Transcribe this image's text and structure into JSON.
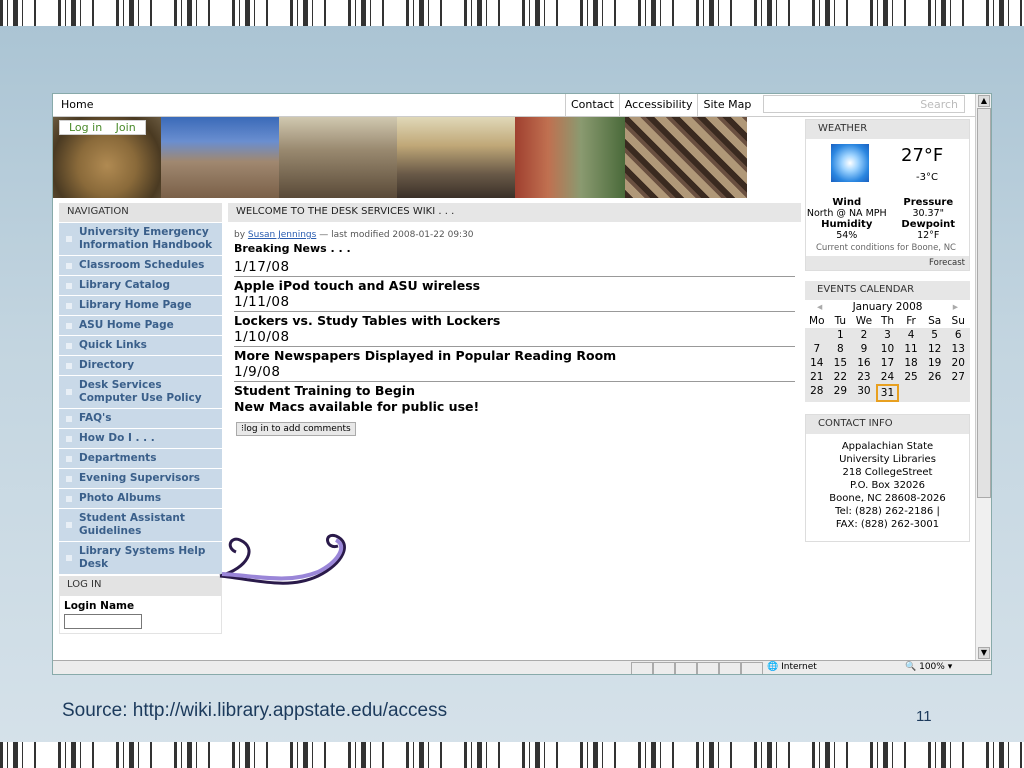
{
  "slide": {
    "source": "Source: http://wiki.library.appstate.edu/access",
    "page_number": "11"
  },
  "topnav": {
    "home": "Home",
    "links": [
      "Contact",
      "Accessibility",
      "Site Map"
    ],
    "search_placeholder": "Search"
  },
  "banner": {
    "login": "Log in",
    "join": "Join"
  },
  "nav": {
    "heading": "NAVIGATION",
    "items": [
      "University Emergency Information Handbook",
      "Classroom Schedules",
      "Library Catalog",
      "Library Home Page",
      "ASU Home Page",
      "Quick Links",
      "Directory",
      "Desk Services Computer Use Policy",
      "FAQ's",
      "How Do I . . .",
      "Departments",
      "Evening Supervisors",
      "Photo Albums",
      "Student Assistant Guidelines",
      "Library Systems Help Desk"
    ],
    "login_heading": "LOG IN",
    "login_label": "Login Name"
  },
  "content": {
    "heading": "WELCOME TO THE DESK SERVICES WIKI . . .",
    "byline_prefix": "by",
    "author": "Susan Jennings",
    "byline_suffix": "— last modified 2008-01-22 09:30",
    "breaking": "Breaking News . . .",
    "news": [
      {
        "date": "1/17/08",
        "title": "Apple iPod touch and ASU wireless"
      },
      {
        "date": "1/11/08",
        "title": "Lockers vs. Study Tables with Lockers"
      },
      {
        "date": "1/10/08",
        "title": "More Newspapers Displayed in Popular Reading Room"
      },
      {
        "date": "1/9/08",
        "title": "Student Training to Begin"
      }
    ],
    "extra_title": "New Macs available for public use!",
    "comment_button": "log in to add comments"
  },
  "weather": {
    "heading": "WEATHER",
    "temp_f": "27°F",
    "temp_c": "-3°C",
    "wind_label": "Wind",
    "wind_value": "North @ NA MPH",
    "pressure_label": "Pressure",
    "pressure_value": "30.37\"",
    "humidity_label": "Humidity",
    "humidity_value": "54%",
    "dewpoint_label": "Dewpoint",
    "dewpoint_value": "12°F",
    "conditions": "Current conditions for Boone, NC",
    "forecast": "Forecast"
  },
  "calendar": {
    "heading": "EVENTS CALENDAR",
    "month": "January 2008",
    "prev": "◂",
    "next": "▸",
    "weekdays": [
      "Mo",
      "Tu",
      "We",
      "Th",
      "Fr",
      "Sa",
      "Su"
    ],
    "days": [
      "",
      "1",
      "2",
      "3",
      "4",
      "5",
      "6",
      "7",
      "8",
      "9",
      "10",
      "11",
      "12",
      "13",
      "14",
      "15",
      "16",
      "17",
      "18",
      "19",
      "20",
      "21",
      "22",
      "23",
      "24",
      "25",
      "26",
      "27",
      "28",
      "29",
      "30",
      "31",
      "",
      "",
      ""
    ],
    "today": "31"
  },
  "contact": {
    "heading": "CONTACT INFO",
    "lines": [
      "Appalachian State",
      "University Libraries",
      "218 CollegeStreet",
      "P.O. Box 32026",
      "Boone, NC 28608-2026",
      "Tel: (828) 262-2186 |",
      "FAX: (828) 262-3001"
    ]
  },
  "status": {
    "zone": "Internet",
    "zoom": "100%"
  },
  "colors": {
    "nav_bg": "#c9d9e8",
    "nav_text": "#3a5f8a",
    "link": "#2a5db0",
    "login_green": "#4a8a2a"
  }
}
